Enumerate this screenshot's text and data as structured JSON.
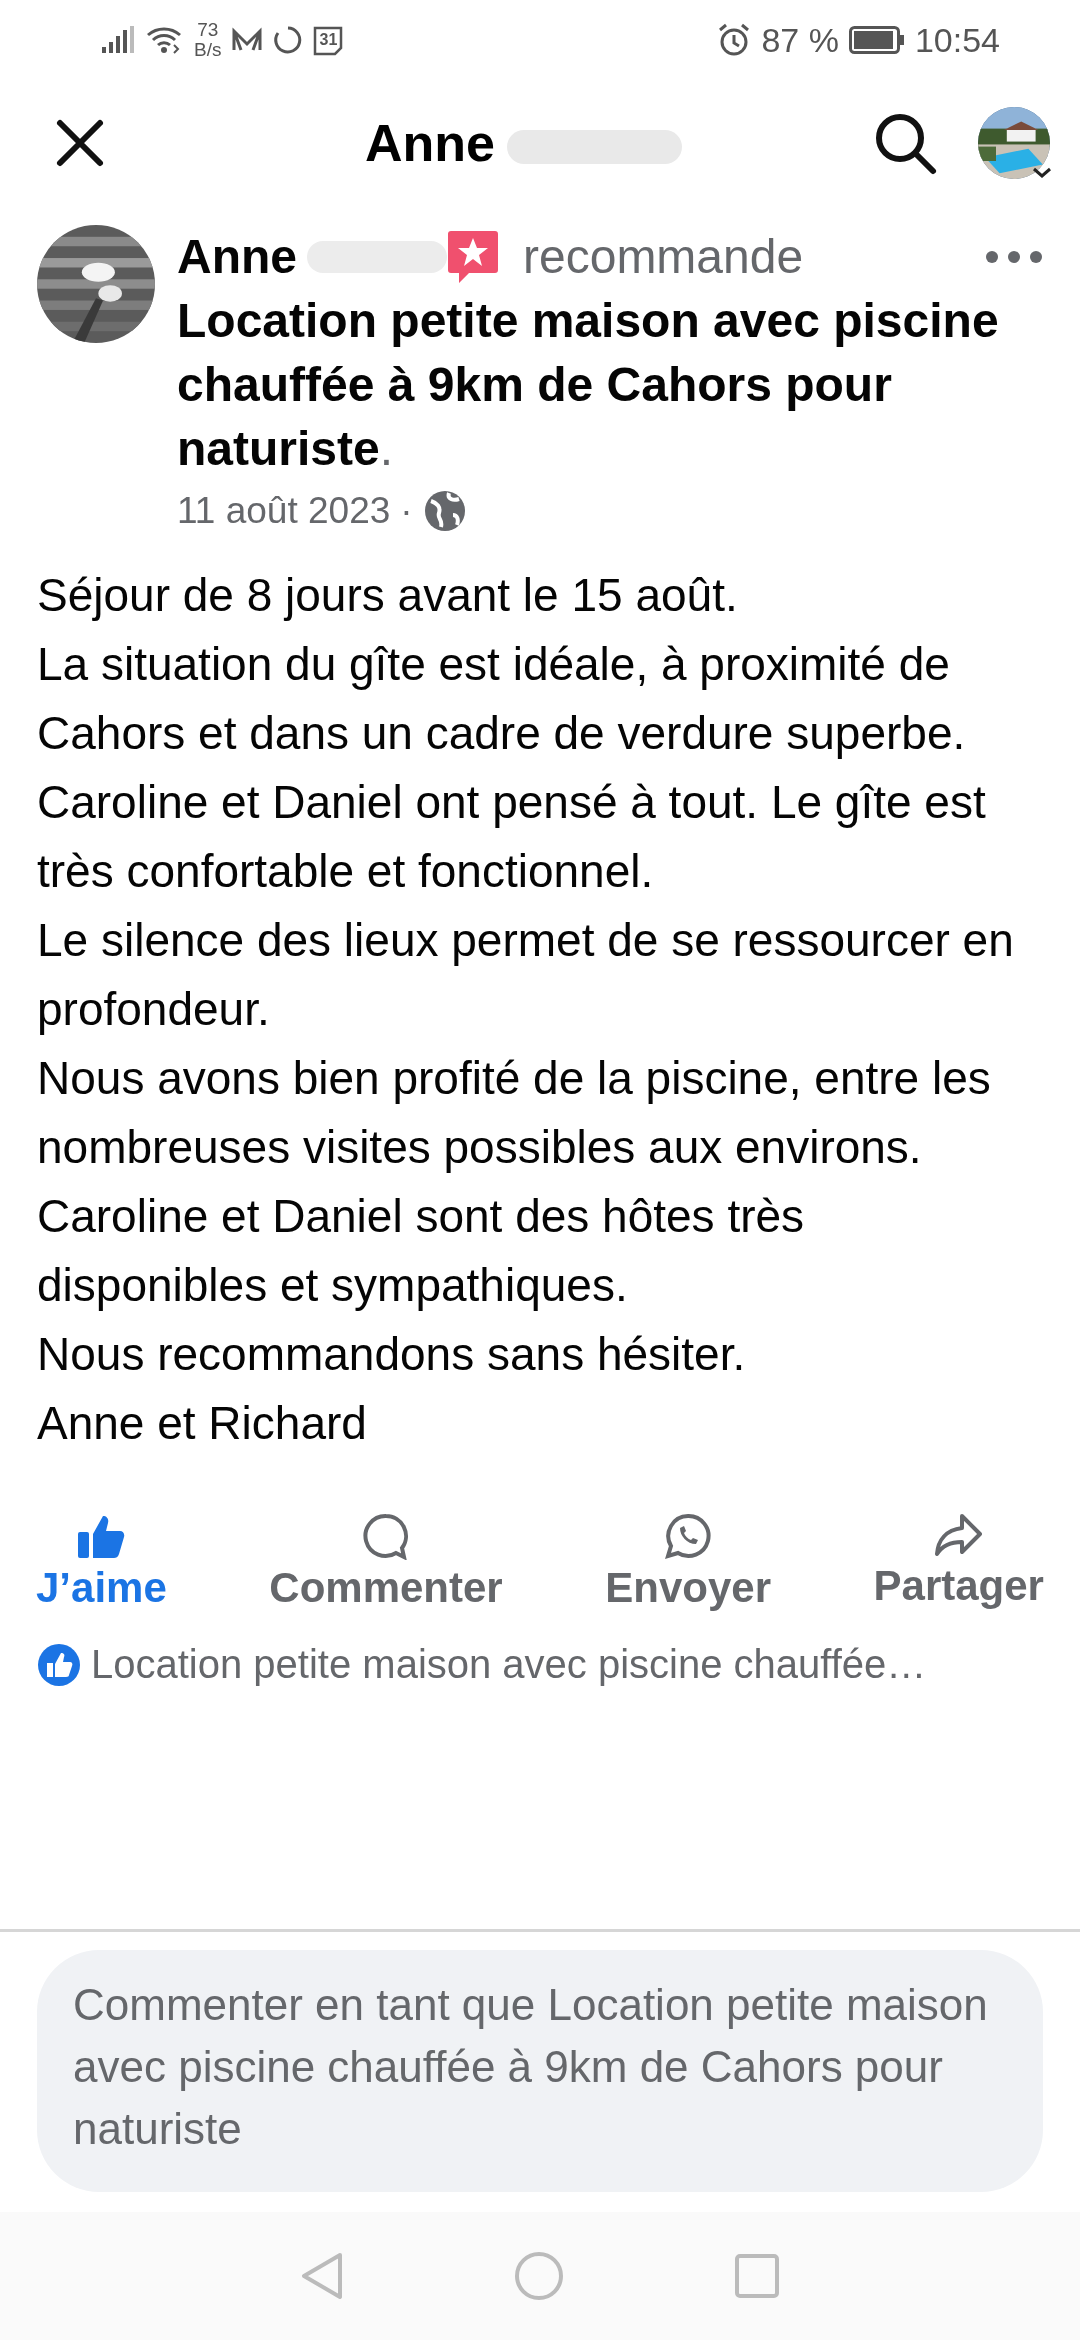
{
  "status_bar": {
    "network_speed": "73",
    "network_unit": "B/s",
    "calendar_day": "31",
    "battery": "87 %",
    "time": "10:54"
  },
  "header": {
    "title": "Anne"
  },
  "post": {
    "author": "Anne",
    "action": "recommande",
    "page_title": "Location petite maison avec piscine chauffée à 9km de Cahors pour naturiste",
    "title_suffix": ".",
    "date": "11 août 2023",
    "separator": "·",
    "body": [
      "Séjour de 8 jours avant le 15 août.",
      "La situation du gîte est idéale, à proximité de Cahors et dans un cadre de verdure superbe.",
      "Caroline et Daniel ont pensé à tout.  Le gîte est très confortable et fonctionnel.",
      "Le silence des lieux permet de se ressourcer en profondeur.",
      "Nous avons bien profité de la piscine, entre les nombreuses visites possibles aux environs.",
      "Caroline et Daniel sont des hôtes très disponibles et sympathiques.",
      "Nous recommandons sans hésiter.",
      "Anne et Richard"
    ]
  },
  "actions": [
    {
      "kind": "like",
      "label": "J’aime",
      "active": true
    },
    {
      "kind": "comment",
      "label": "Commenter",
      "active": false
    },
    {
      "kind": "send",
      "label": "Envoyer",
      "active": false
    },
    {
      "kind": "share",
      "label": "Partager",
      "active": false
    }
  ],
  "reactions": {
    "text": "Location petite maison avec piscine chauffée…"
  },
  "comment_box": {
    "placeholder": "Commenter en tant que Location petite maison avec piscine chauffée à 9km de Cahors pour naturiste"
  }
}
